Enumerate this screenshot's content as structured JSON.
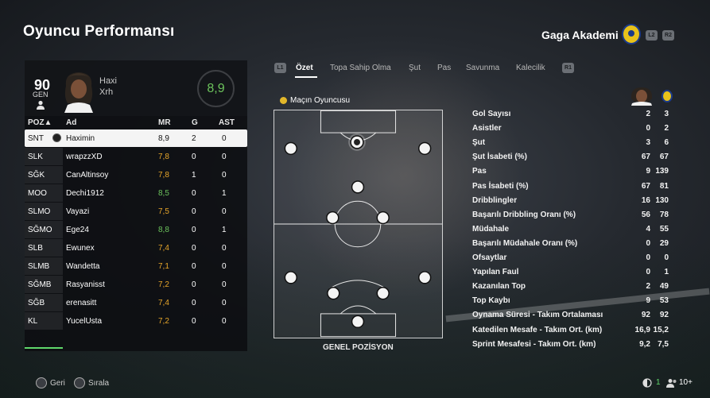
{
  "header": {
    "title": "Oyuncu Performansı",
    "club_name": "Gaga Akademi",
    "hints": [
      "L2",
      "R2"
    ]
  },
  "player_card": {
    "overall": "90",
    "position": "GEN",
    "first_name": "Haxi",
    "last_name": "Xrh",
    "match_rating": "8,9"
  },
  "table": {
    "headers": {
      "pos": "POZ▲",
      "name": "Ad",
      "mr": "MR",
      "g": "G",
      "ast": "AST"
    },
    "rows": [
      {
        "pos": "SNT",
        "name": "Haximin",
        "mr": "8,9",
        "g": "2",
        "ast": "0",
        "mr_color": "#111111",
        "selected": true
      },
      {
        "pos": "SLK",
        "name": "wrapzzXD",
        "mr": "7,8",
        "g": "0",
        "ast": "0",
        "mr_color": "#e6a52a"
      },
      {
        "pos": "SĞK",
        "name": "CanAltinsoy",
        "mr": "7,8",
        "g": "1",
        "ast": "0",
        "mr_color": "#e6a52a"
      },
      {
        "pos": "MOO",
        "name": "Dechi1912",
        "mr": "8,5",
        "g": "0",
        "ast": "1",
        "mr_color": "#6cc35c"
      },
      {
        "pos": "SLMO",
        "name": "Vayazi",
        "mr": "7,5",
        "g": "0",
        "ast": "0",
        "mr_color": "#e6a52a"
      },
      {
        "pos": "SĞMO",
        "name": "Ege24",
        "mr": "8,8",
        "g": "0",
        "ast": "1",
        "mr_color": "#6cc35c"
      },
      {
        "pos": "SLB",
        "name": "Ewunex",
        "mr": "7,4",
        "g": "0",
        "ast": "0",
        "mr_color": "#e6a52a"
      },
      {
        "pos": "SLMB",
        "name": "Wandetta",
        "mr": "7,1",
        "g": "0",
        "ast": "0",
        "mr_color": "#e6a52a"
      },
      {
        "pos": "SĞMB",
        "name": "Rasyanisst",
        "mr": "7,2",
        "g": "0",
        "ast": "0",
        "mr_color": "#e6a52a"
      },
      {
        "pos": "SĞB",
        "name": "erenasitt",
        "mr": "7,4",
        "g": "0",
        "ast": "0",
        "mr_color": "#e6a52a"
      },
      {
        "pos": "KL",
        "name": "YucelUsta",
        "mr": "7,2",
        "g": "0",
        "ast": "0",
        "mr_color": "#e6a52a"
      }
    ]
  },
  "tabs": {
    "left_hint": "L1",
    "right_hint": "R1",
    "items": [
      "Özet",
      "Topa Sahip Olma",
      "Şut",
      "Pas",
      "Savunma",
      "Kalecilik"
    ],
    "active_index": 0
  },
  "pitch": {
    "motm_label": "Maçın Oyuncusu",
    "caption": "GENEL POZİSYON"
  },
  "stats": [
    {
      "label": "Gol Sayısı",
      "v1": "2",
      "v2": "3"
    },
    {
      "label": "Asistler",
      "v1": "0",
      "v2": "2"
    },
    {
      "label": "Şut",
      "v1": "3",
      "v2": "6"
    },
    {
      "label": "Şut İsabeti (%)",
      "v1": "67",
      "v2": "67"
    },
    {
      "label": "Pas",
      "v1": "9",
      "v2": "139"
    },
    {
      "label": "Pas İsabeti (%)",
      "v1": "67",
      "v2": "81"
    },
    {
      "label": "Dribblingler",
      "v1": "16",
      "v2": "130"
    },
    {
      "label": "Başarılı Dribbling Oranı (%)",
      "v1": "56",
      "v2": "78"
    },
    {
      "label": "Müdahale",
      "v1": "4",
      "v2": "55"
    },
    {
      "label": "Başarılı Müdahale Oranı (%)",
      "v1": "0",
      "v2": "29"
    },
    {
      "label": "Ofsaytlar",
      "v1": "0",
      "v2": "0"
    },
    {
      "label": "Yapılan Faul",
      "v1": "0",
      "v2": "1"
    },
    {
      "label": "Kazanılan Top",
      "v1": "2",
      "v2": "49"
    },
    {
      "label": "Top Kaybı",
      "v1": "9",
      "v2": "53"
    },
    {
      "label": "Oynama Süresi - Takım Ortalaması",
      "v1": "92",
      "v2": "92"
    },
    {
      "label": "Katedilen Mesafe - Takım Ort. (km)",
      "v1": "16,9",
      "v2": "15,2"
    },
    {
      "label": "Sprint Mesafesi - Takım Ort. (km)",
      "v1": "9,2",
      "v2": "7,5"
    }
  ],
  "footer": {
    "back_label": "Geri",
    "sort_label": "Sırala",
    "count": "1",
    "players": "10+"
  },
  "colors": {
    "accent_green": "#5fd86b",
    "rating_green": "#6cc35c",
    "rating_orange": "#e6a52a"
  }
}
